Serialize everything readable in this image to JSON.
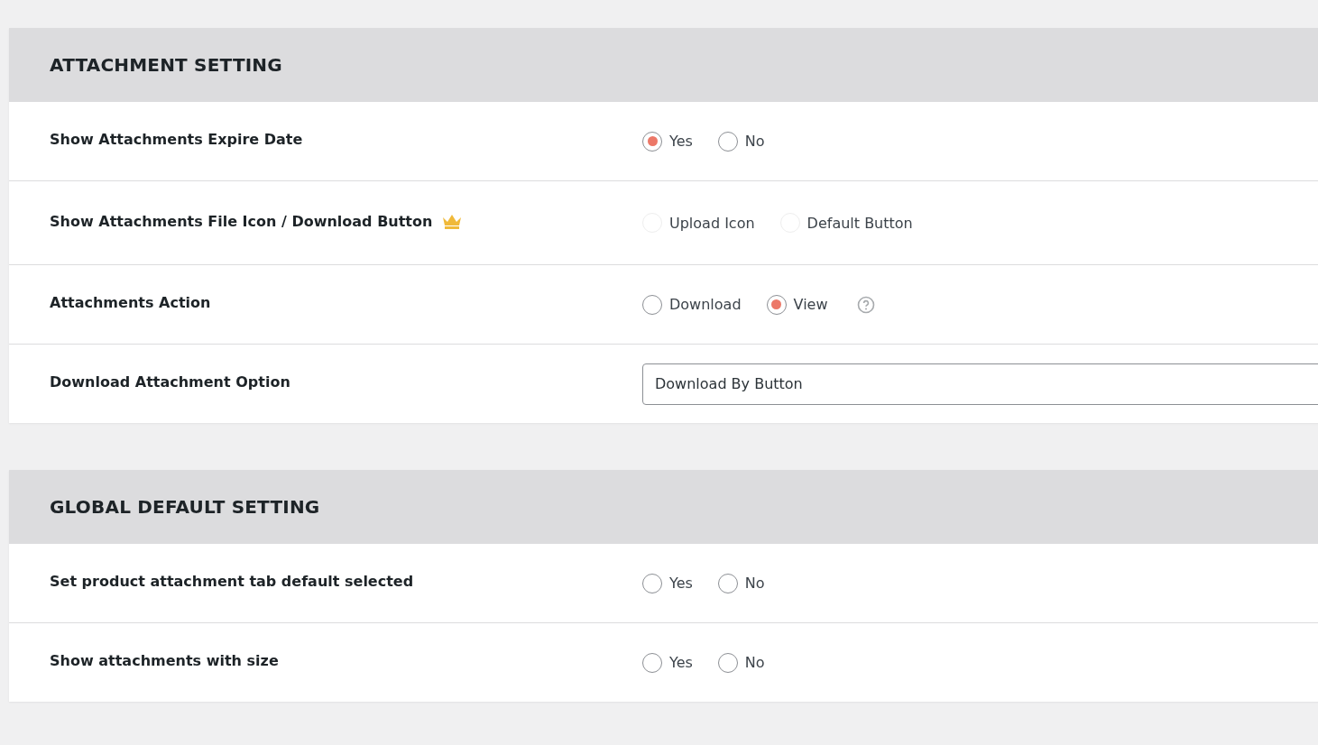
{
  "sections": [
    {
      "title": "ATTACHMENT SETTING",
      "rows": [
        {
          "kind": "radio",
          "label": "Show Attachments Expire Date",
          "pro": false,
          "help": false,
          "options": [
            {
              "label": "Yes",
              "selected": true,
              "disabled": false
            },
            {
              "label": "No",
              "selected": false,
              "disabled": false
            }
          ]
        },
        {
          "kind": "radio",
          "label": "Show Attachments File Icon / Download Button",
          "pro": true,
          "help": false,
          "options": [
            {
              "label": "Upload Icon",
              "selected": false,
              "disabled": true
            },
            {
              "label": "Default Button",
              "selected": false,
              "disabled": true
            }
          ]
        },
        {
          "kind": "radio",
          "label": "Attachments Action",
          "pro": false,
          "help": true,
          "options": [
            {
              "label": "Download",
              "selected": false,
              "disabled": false
            },
            {
              "label": "View",
              "selected": true,
              "disabled": false
            }
          ]
        },
        {
          "kind": "select",
          "label": "Download Attachment Option",
          "pro": false,
          "value": "Download By Button"
        }
      ]
    },
    {
      "title": "GLOBAL DEFAULT SETTING",
      "rows": [
        {
          "kind": "radio",
          "label": "Set product attachment tab default selected",
          "pro": false,
          "help": false,
          "options": [
            {
              "label": "Yes",
              "selected": false,
              "disabled": false
            },
            {
              "label": "No",
              "selected": false,
              "disabled": false
            }
          ]
        },
        {
          "kind": "radio",
          "label": "Show attachments with size",
          "pro": false,
          "help": false,
          "options": [
            {
              "label": "Yes",
              "selected": false,
              "disabled": false
            },
            {
              "label": "No",
              "selected": false,
              "disabled": false
            }
          ]
        }
      ]
    }
  ]
}
